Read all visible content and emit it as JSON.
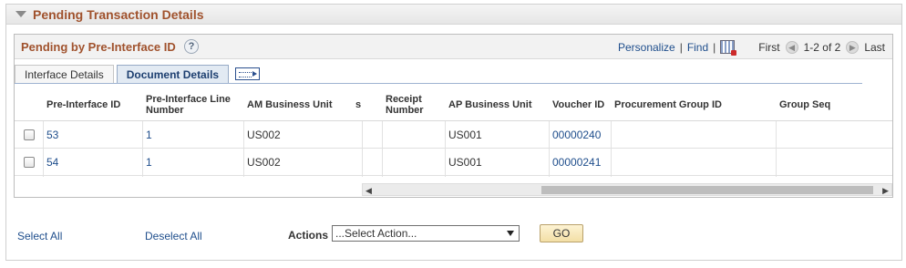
{
  "section": {
    "title": "Pending Transaction Details"
  },
  "grid": {
    "title": "Pending by Pre-Interface ID",
    "help": "?",
    "toolbar": {
      "personalize": "Personalize",
      "find": "Find",
      "sep": "|",
      "first": "First",
      "range": "1-2 of 2",
      "last": "Last"
    },
    "tabs": [
      "Interface Details",
      "Document Details"
    ],
    "columns": [
      "Pre-Interface ID",
      "Pre-Interface Line Number",
      "AM Business Unit",
      "s",
      "Receipt Number",
      "AP Business Unit",
      "Voucher ID",
      "Procurement Group ID",
      "Group Seq"
    ],
    "rows": [
      {
        "pre_interface_id": "53",
        "line_number": "1",
        "am_bu": "US002",
        "ap_bu": "US001",
        "voucher_id": "00000240"
      },
      {
        "pre_interface_id": "54",
        "line_number": "1",
        "am_bu": "US002",
        "ap_bu": "US001",
        "voucher_id": "00000241"
      }
    ]
  },
  "footer": {
    "select_all": "Select All",
    "deselect_all": "Deselect All",
    "actions_label": "Actions",
    "action_value": "...Select Action...",
    "go": "GO"
  }
}
